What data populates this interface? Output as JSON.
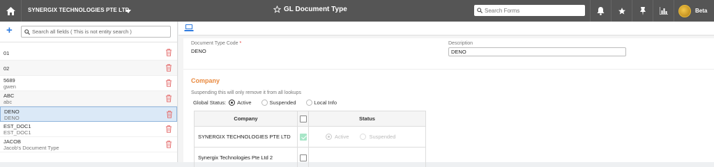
{
  "topbar": {
    "company": "SYNERGIX TECHNOLOGIES PTE LTD",
    "page_title": "GL Document Type",
    "search_placeholder": "Search Forms",
    "beta_label": "Beta"
  },
  "left": {
    "search_placeholder": "Search all fields ( This is not entity search )",
    "items": [
      {
        "code": "01",
        "desc": ""
      },
      {
        "code": "02",
        "desc": ""
      },
      {
        "code": "5689",
        "desc": "gwen"
      },
      {
        "code": "ABC",
        "desc": "abc"
      },
      {
        "code": "DENO",
        "desc": "DENO"
      },
      {
        "code": "EST_DOC1",
        "desc": "EST_DOC1"
      },
      {
        "code": "JACOB",
        "desc": "Jacob's Document Type"
      }
    ],
    "selected_code": "DENO"
  },
  "form": {
    "code_label": "Document Type Code",
    "code_value": "DENO",
    "description_label": "Description",
    "description_value": "DENO"
  },
  "company_section": {
    "title": "Company",
    "note": "Suspending this will only remove it from all lookups",
    "global_status_label": "Global Status:",
    "options": [
      "Active",
      "Suspended",
      "Local Info"
    ],
    "selected": "Active",
    "table": {
      "headers": {
        "company": "Company",
        "status": "Status"
      },
      "rows": [
        {
          "company": "SYNERGIX TECHNOLOGIES PTE LTD",
          "checked": true,
          "status_active": "Active",
          "status_suspended": "Suspended"
        },
        {
          "company": "Synergix Technologies Pte Ltd 2",
          "checked": false,
          "status_active": "",
          "status_suspended": ""
        }
      ]
    }
  },
  "colors": {
    "topbar": "#555555",
    "accent_blue": "#2d7be0",
    "section_orange": "#e98a40",
    "trash_red": "#e57373",
    "selected_row": "#dbe9f7"
  }
}
